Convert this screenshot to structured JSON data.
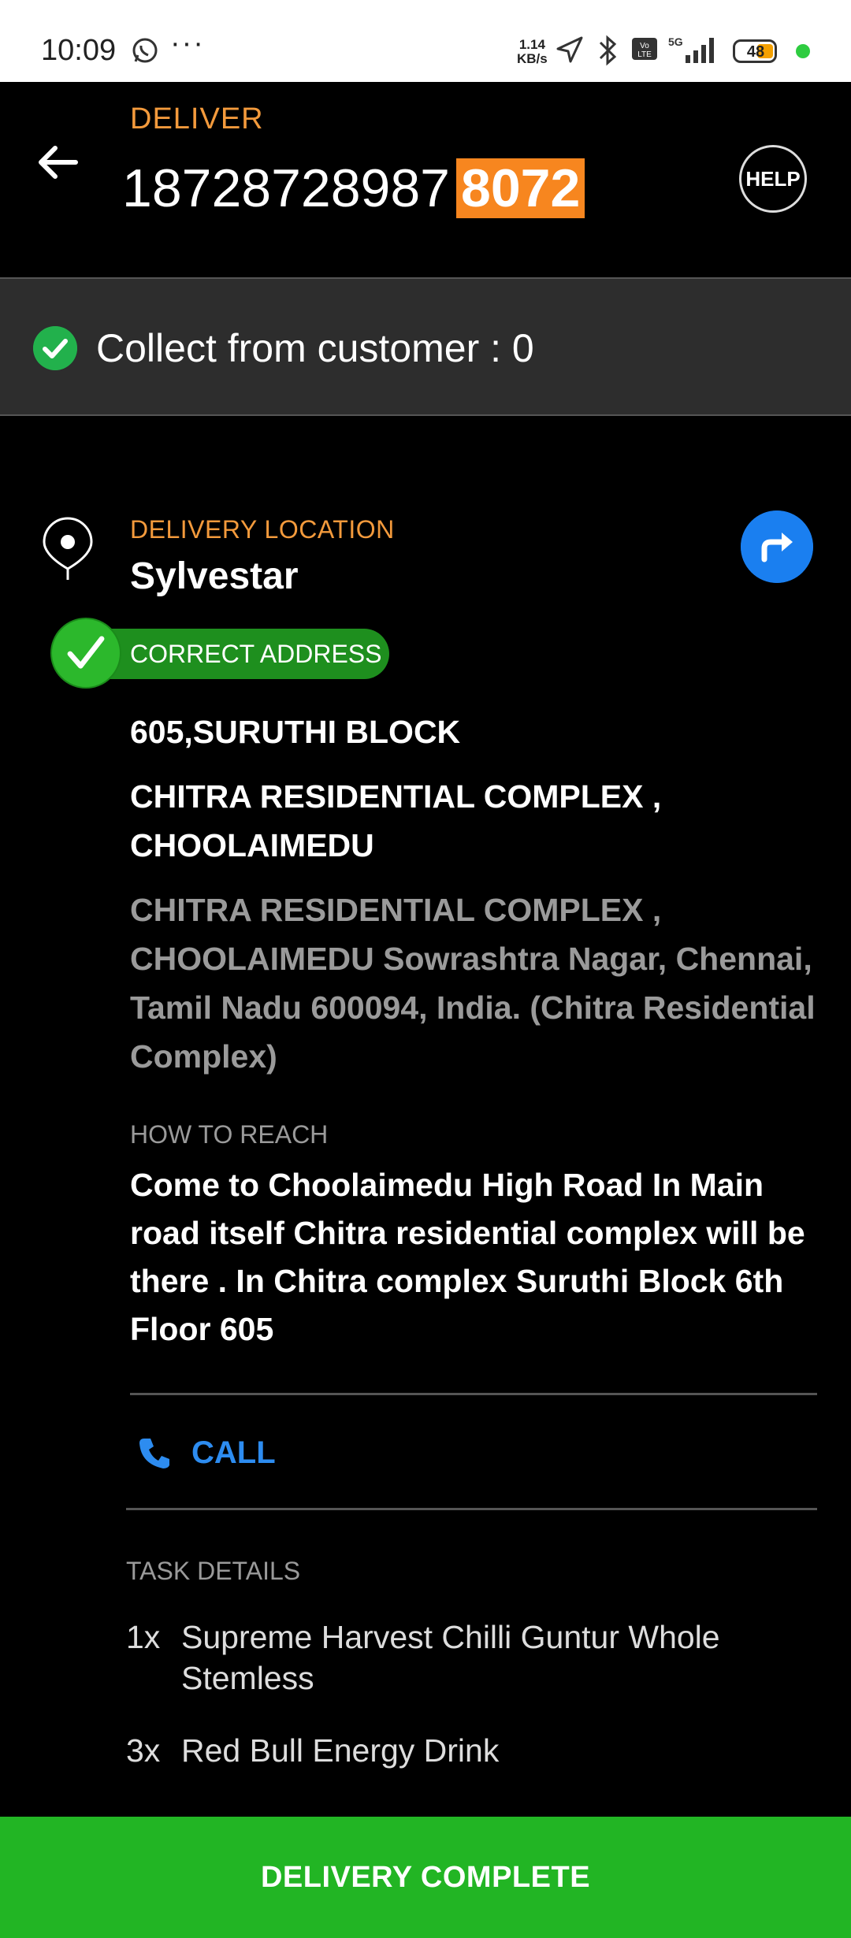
{
  "status_bar": {
    "time": "10:09",
    "more": "···",
    "net_speed_value": "1.14",
    "net_speed_unit": "KB/s",
    "battery": "48",
    "icons": [
      "whatsapp-icon",
      "location-arrow-icon",
      "bluetooth-icon",
      "volte-icon",
      "5g-signal-icon",
      "battery-icon"
    ]
  },
  "header": {
    "label": "DELIVER",
    "order_number": "18728728987",
    "order_suffix": "8072",
    "help_label": "HELP"
  },
  "collect": {
    "text": "Collect from customer : 0"
  },
  "location": {
    "label": "DELIVERY LOCATION",
    "name": "Sylvestar",
    "badge": "CORRECT ADDRESS",
    "line1": "605,SURUTHI BLOCK",
    "line2": "CHITRA RESIDENTIAL COMPLEX , CHOOLAIMEDU",
    "full_address": "CHITRA RESIDENTIAL COMPLEX , CHOOLAIMEDU Sowrashtra Nagar, Chennai, Tamil Nadu 600094, India. (Chitra Residential Complex)"
  },
  "how_to_reach": {
    "label": "HOW TO REACH",
    "text": "Come to Choolaimedu High Road In Main road itself Chitra residential complex will be there . In Chitra complex Suruthi Block 6th Floor 605"
  },
  "call": {
    "label": "CALL"
  },
  "task_details": {
    "label": "TASK DETAILS",
    "items": [
      {
        "qty": "1x",
        "name": "Supreme Harvest Chilli Guntur Whole Stemless"
      },
      {
        "qty": "3x",
        "name": "Red Bull Energy Drink"
      }
    ]
  },
  "footer": {
    "button": "DELIVERY COMPLETE"
  },
  "colors": {
    "accent_orange": "#f39a3c",
    "highlight_orange": "#f7861f",
    "nav_blue": "#1a7ff0",
    "call_blue": "#2d8cf0",
    "success_green": "#22b524"
  }
}
